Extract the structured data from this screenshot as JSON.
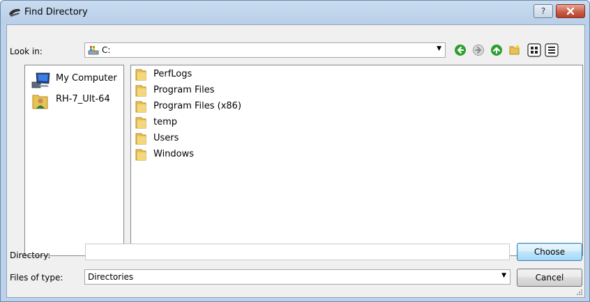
{
  "window": {
    "title": "Find Directory",
    "help_label": "?",
    "close_label": "x"
  },
  "toolbar": {
    "look_in_label": "Look in:",
    "look_in_value": "C:",
    "back_icon": "back-arrow-icon",
    "forward_icon": "forward-arrow-icon",
    "up_icon": "up-arrow-icon",
    "new_folder_icon": "new-folder-icon",
    "list_view_icon": "list-view-icon",
    "detail_view_icon": "detail-view-icon"
  },
  "sidebar": {
    "items": [
      {
        "label": "My Computer",
        "icon": "computer-icon"
      },
      {
        "label": "RH-7_Ult-64",
        "icon": "user-folder-icon"
      }
    ]
  },
  "files": {
    "items": [
      {
        "label": "PerfLogs"
      },
      {
        "label": "Program Files"
      },
      {
        "label": "Program Files (x86)"
      },
      {
        "label": "temp"
      },
      {
        "label": "Users"
      },
      {
        "label": "Windows"
      }
    ]
  },
  "form": {
    "directory_label": "Directory:",
    "directory_value": "",
    "files_of_type_label": "Files of type:",
    "files_of_type_value": "Directories",
    "choose_label": "Choose",
    "cancel_label": "Cancel"
  },
  "colors": {
    "titlebar": "#bcd2ea",
    "close_button": "#c85a44",
    "folder": "#e8c255",
    "nav_green": "#2e9e2e"
  }
}
